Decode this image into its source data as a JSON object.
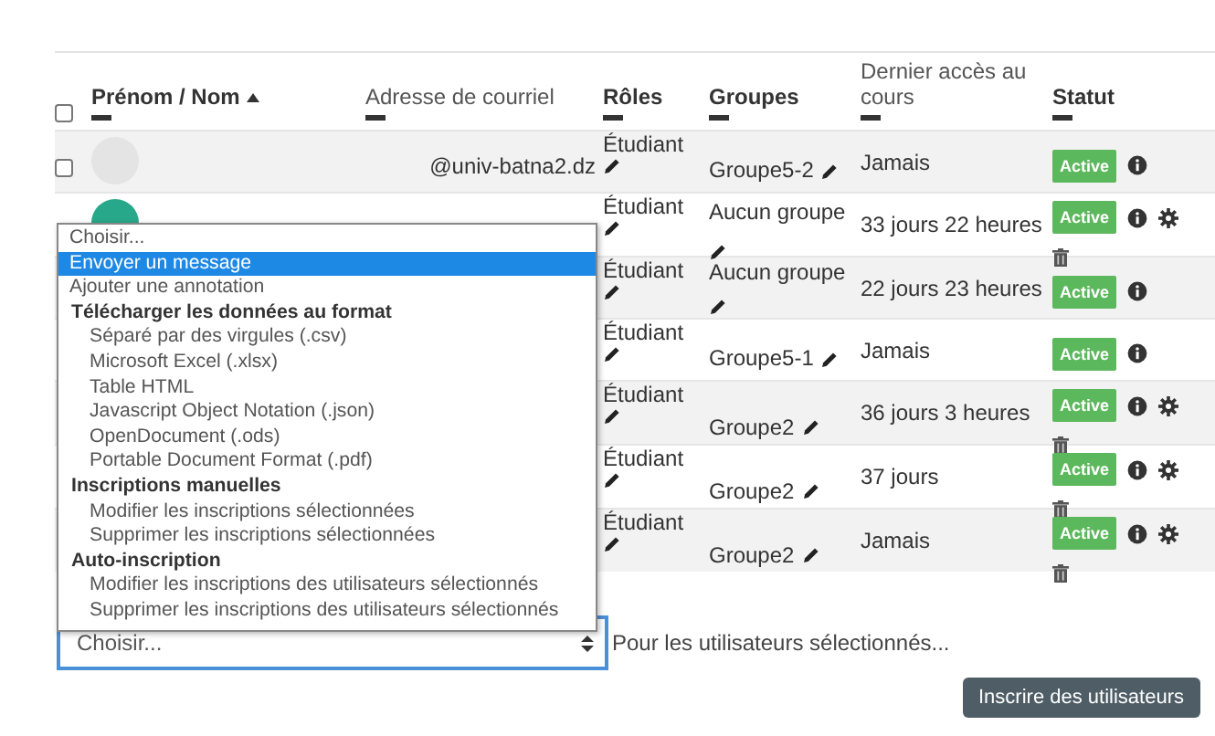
{
  "table": {
    "select_all": {
      "checked": false
    },
    "columns": [
      {
        "label": "Prénom / Nom",
        "sorted_ascending": true
      },
      {
        "label": "Adresse de courriel"
      },
      {
        "label": "Rôles"
      },
      {
        "label": "Groupes"
      },
      {
        "label": "Dernier accès au cours"
      },
      {
        "label": "Statut"
      }
    ],
    "rows": [
      {
        "checked": false,
        "avatar": {
          "kind": "blank"
        },
        "email": "@univ-batna2.dz",
        "role": "Étudiant",
        "group": "Groupe5-2",
        "last_access": "Jamais",
        "status": "Active",
        "manage": false
      },
      {
        "avatar": {
          "kind": "photo"
        },
        "role": "Étudiant",
        "group": "Aucun groupe",
        "last_access": "33 jours 22 heures",
        "status": "Active",
        "manage": true
      },
      {
        "role": "Étudiant",
        "group": "Aucun groupe",
        "last_access": "22 jours 23 heures",
        "status": "Active",
        "manage": false
      },
      {
        "role": "Étudiant",
        "group": "Groupe5-1",
        "last_access": "Jamais",
        "status": "Active",
        "manage": false
      },
      {
        "role": "Étudiant",
        "group": "Groupe2",
        "last_access": "36 jours 3 heures",
        "status": "Active",
        "manage": true
      },
      {
        "role": "Étudiant",
        "group": "Groupe2",
        "last_access": "37 jours",
        "status": "Active",
        "manage": true
      },
      {
        "role": "Étudiant",
        "group": "Groupe2",
        "last_access": "Jamais",
        "status": "Active",
        "manage": true
      }
    ]
  },
  "bulk_action": {
    "value": "Choisir...",
    "label": "Pour les utilisateurs sélectionnés...",
    "dropdown": [
      {
        "kind": "option",
        "label": "Choisir...",
        "highlighted": false
      },
      {
        "kind": "option",
        "label": "Envoyer un message",
        "highlighted": true
      },
      {
        "kind": "option",
        "label": "Ajouter une annotation",
        "highlighted": false
      },
      {
        "kind": "group",
        "label": "Télécharger les données au format",
        "children": [
          {
            "label": "Séparé par des virgules (.csv)",
            "highlighted": false
          },
          {
            "label": "Microsoft Excel (.xlsx)",
            "highlighted": false
          },
          {
            "label": "Table HTML",
            "highlighted": false
          },
          {
            "label": "Javascript Object Notation (.json)",
            "highlighted": false
          },
          {
            "label": "OpenDocument (.ods)",
            "highlighted": false
          },
          {
            "label": "Portable Document Format (.pdf)",
            "highlighted": false
          }
        ]
      },
      {
        "kind": "group",
        "label": "Inscriptions manuelles",
        "children": [
          {
            "label": "Modifier les inscriptions sélectionnées",
            "highlighted": false
          },
          {
            "label": "Supprimer les inscriptions sélectionnées",
            "highlighted": false
          }
        ]
      },
      {
        "kind": "group",
        "label": "Auto-inscription",
        "children": [
          {
            "label": "Modifier les inscriptions des utilisateurs sélectionnés",
            "highlighted": false
          },
          {
            "label": "Supprimer les inscriptions des utilisateurs sélectionnés",
            "highlighted": false
          }
        ]
      }
    ]
  },
  "enrol_button": "Inscrire des utilisateurs"
}
